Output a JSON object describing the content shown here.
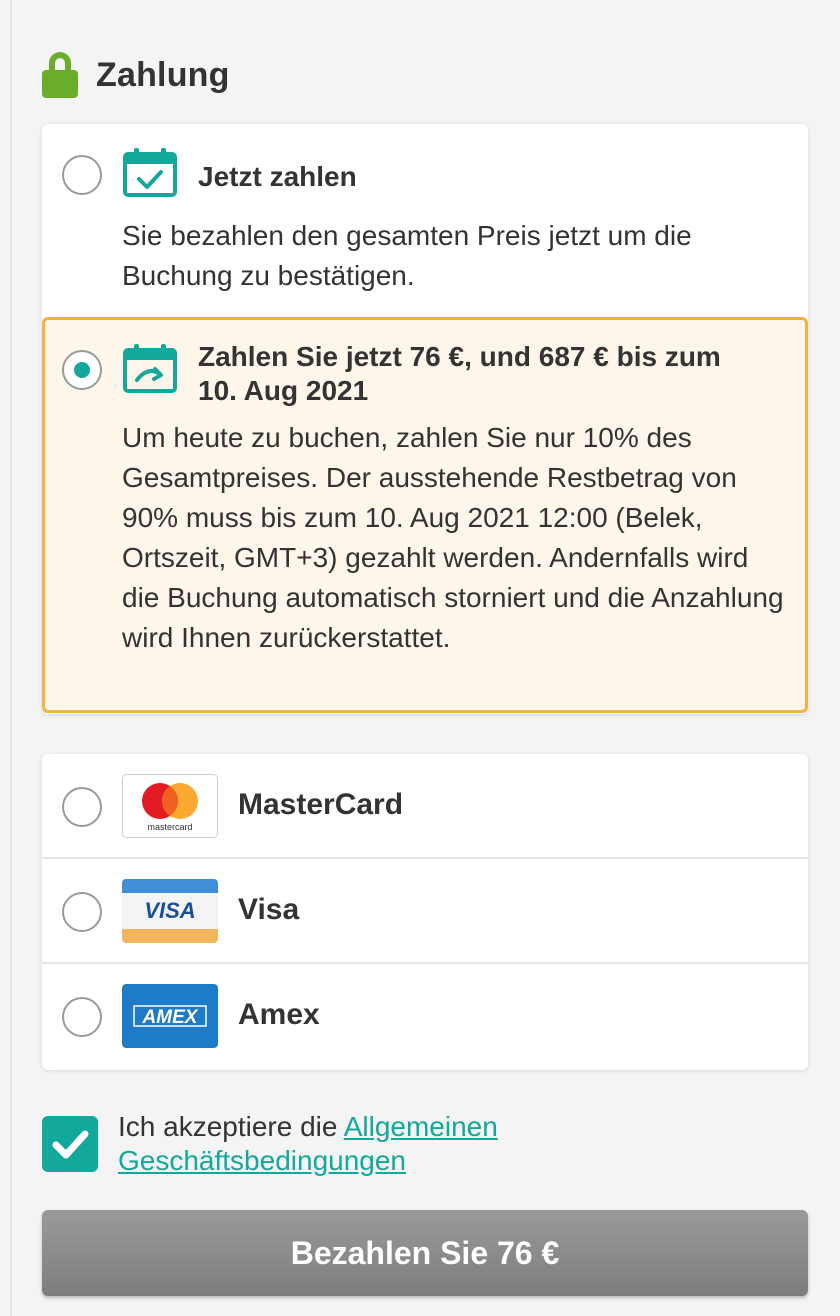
{
  "section": {
    "title": "Zahlung"
  },
  "plans": [
    {
      "title": "Jetzt zahlen",
      "description": "Sie bezahlen den gesamten Preis jetzt um die Buchung zu bestätigen.",
      "selected": false,
      "icon": "calendar-check-icon"
    },
    {
      "title": "Zahlen Sie jetzt 76 €, und 687 € bis zum 10. Aug 2021",
      "description": "Um heute zu buchen, zahlen Sie nur 10% des Gesamtpreises. Der ausstehende Restbetrag von 90% muss bis zum 10. Aug 2021 12:00 (Belek, Ortszeit, GMT+3) gezahlt werden. Andernfalls wird die Buchung automatisch storniert und die Anzahlung wird Ihnen zurückerstattet.",
      "selected": true,
      "icon": "calendar-installment-icon"
    }
  ],
  "payment_methods": [
    {
      "label": "MasterCard",
      "logo_text": "mastercard",
      "icon": "mastercard-logo"
    },
    {
      "label": "Visa",
      "logo_text": "VISA",
      "icon": "visa-logo"
    },
    {
      "label": "Amex",
      "logo_text": "AMEX",
      "icon": "amex-logo"
    }
  ],
  "terms": {
    "prefix": "Ich akzeptiere die ",
    "link": "Allgemeinen Geschäftsbedingungen",
    "checked": true
  },
  "pay_button": {
    "label": "Bezahlen Sie 76 €"
  },
  "colors": {
    "accent": "#12a89b",
    "lock": "#6cac2b",
    "selected_border": "#f5b23e",
    "selected_bg": "#fef5eb",
    "button": "#8a8a8a"
  }
}
